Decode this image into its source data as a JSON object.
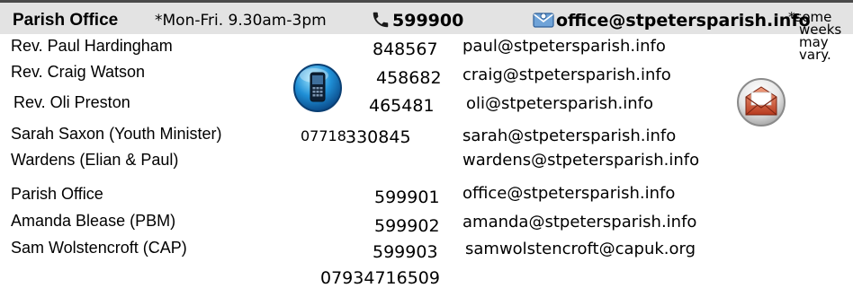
{
  "header": {
    "title": "Parish Office",
    "hours": "*Mon-Fri. 9.30am-3pm",
    "phone": "599900",
    "email": "office@stpetersparish.info",
    "background": "#e3e3e3"
  },
  "note": {
    "line1": "*some",
    "line2": "weeks",
    "line3": "may",
    "line4": "vary."
  },
  "contacts": [
    {
      "name": "Rev. Paul Hardingham",
      "phone": "848567",
      "email": "paul@stpetersparish.info"
    },
    {
      "name": "Rev. Craig Watson",
      "phone": "458682",
      "email": "craig@stpetersparish.info"
    },
    {
      "name": "Rev. Oli Preston",
      "phone": "465481",
      "email": "oli@stpetersparish.info"
    },
    {
      "name": "Sarah Saxon (Youth Minister)",
      "prefix": "07718",
      "phone": "330845",
      "email": "sarah@stpetersparish.info"
    },
    {
      "name": "Wardens (Elian & Paul)",
      "phone": "",
      "email": "wardens@stpetersparish.info"
    },
    {
      "name": "Parish Office",
      "phone": "599901",
      "email": "office@stpetersparish.info"
    },
    {
      "name": "Amanda Blease (PBM)",
      "phone": "599902",
      "email": "amanda@stpetersparish.info"
    },
    {
      "name": "Sam Wolstencroft (CAP)",
      "phone": "599903",
      "email": "samwolstencroft@capuk.org"
    }
  ],
  "extra_phone": "07934716509",
  "icons": {
    "header_phone": "phone-handset-icon",
    "header_email": "envelope-icon",
    "mobile": "mobile-phone-icon",
    "mail": "mail-envelope-icon"
  }
}
